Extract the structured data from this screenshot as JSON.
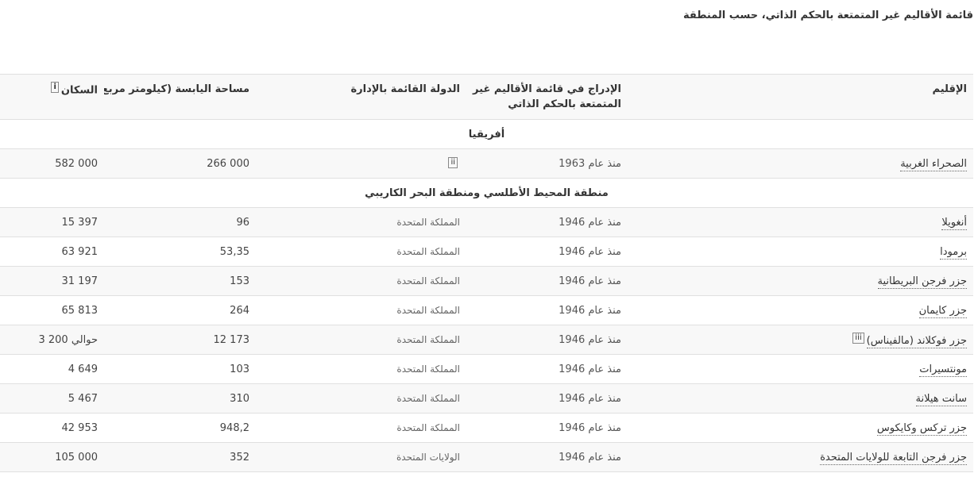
{
  "caption": "قائمة الأقاليم غير المتمتعة بالحكم الذاتي، حسب المنطقة",
  "headers": {
    "territory": "الإقليم",
    "listed": "الإدراج في قائمة الأقاليم غير المتمتعة بالحكم الذاتي",
    "admin": "الدولة القائمة بالإدارة",
    "area": "مساحة اليابسة (كيلومتر مربع)",
    "population": "السكان",
    "population_ref": "i"
  },
  "regions": [
    {
      "name": "أفريقيا"
    },
    {
      "name": "منطقة المحيط الأطلسي ومنطقة البحر الكاريبي"
    }
  ],
  "rows": [
    {
      "territory": "الصحراء الغربية",
      "ref": "",
      "listed": "منذ عام 1963",
      "admin": "",
      "admin_ref": "ii",
      "area": "266 000",
      "population": "582 000"
    },
    {
      "territory": "أنغويلا",
      "ref": "",
      "listed": "منذ عام 1946",
      "admin": "المملكة المتحدة",
      "admin_ref": "",
      "area": "96",
      "population": "15 397"
    },
    {
      "territory": "برمودا",
      "ref": "",
      "listed": "منذ عام 1946",
      "admin": "المملكة المتحدة",
      "admin_ref": "",
      "area": "53,35",
      "population": "63 921"
    },
    {
      "territory": "جزر فرجن البريطانية",
      "ref": "",
      "listed": "منذ عام 1946",
      "admin": "المملكة المتحدة",
      "admin_ref": "",
      "area": "153",
      "population": "31 197"
    },
    {
      "territory": "جزر كايمان",
      "ref": "",
      "listed": "منذ عام 1946",
      "admin": "المملكة المتحدة",
      "admin_ref": "",
      "area": "264",
      "population": "65 813"
    },
    {
      "territory": "جزر فوكلاند (مالفيناس)",
      "ref": "iii",
      "listed": "منذ عام 1946",
      "admin": "المملكة المتحدة",
      "admin_ref": "",
      "area": "12 173",
      "population": "حوالي 200 3"
    },
    {
      "territory": "مونتسيرات",
      "ref": "",
      "listed": "منذ عام 1946",
      "admin": "المملكة المتحدة",
      "admin_ref": "",
      "area": "103",
      "population": "4 649"
    },
    {
      "territory": "سانت هيلانة",
      "ref": "",
      "listed": "منذ عام 1946",
      "admin": "المملكة المتحدة",
      "admin_ref": "",
      "area": "310",
      "population": "5 467"
    },
    {
      "territory": "جزر تركس وكايكوس",
      "ref": "",
      "listed": "منذ عام 1946",
      "admin": "المملكة المتحدة",
      "admin_ref": "",
      "area": "948,2",
      "population": "42 953"
    },
    {
      "territory": "جزر فرجن التابعة للولايات المتحدة",
      "ref": "",
      "listed": "منذ عام 1946",
      "admin": "الولايات المتحدة",
      "admin_ref": "",
      "area": "352",
      "population": "105 000"
    }
  ]
}
